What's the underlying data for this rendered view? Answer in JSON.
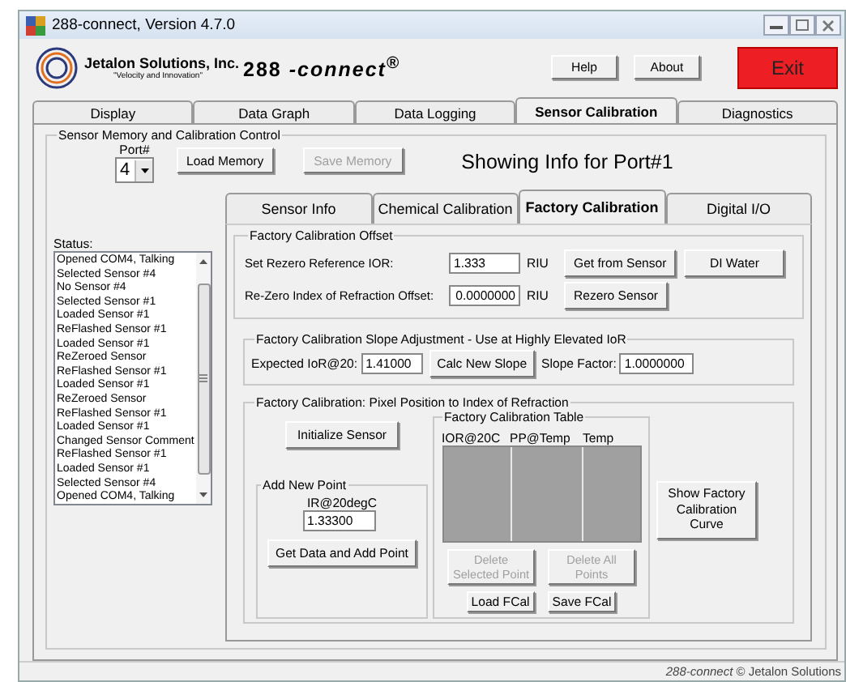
{
  "window": {
    "title": "288-connect, Version 4.7.0"
  },
  "header": {
    "company": "Jetalon Solutions, Inc.",
    "tagline": "\"Velocity and Innovation\"",
    "product": "288 *-connect*$^{®}$",
    "buttons": [
      {
        "label": "Help",
        "disabled": false
      },
      {
        "label": "About",
        "disabled": false
      }
    ],
    "exit": "Exit"
  },
  "tabs": [
    {
      "label": "Display",
      "selected": false
    },
    {
      "label": "Data Graph",
      "selected": false
    },
    {
      "label": "Data Logging",
      "selected": false
    },
    {
      "label": "Sensor Calibration",
      "selected": true
    },
    {
      "label": "Diagnostics",
      "selected": false
    }
  ],
  "memory_group": {
    "title": "Sensor Memory and Calibration Control",
    "port_label": "Port#",
    "port_value": "4",
    "buttons": [
      {
        "label": "Load Memory",
        "disabled": false
      },
      {
        "label": "Save Memory",
        "disabled": true
      }
    ],
    "showing": "Showing Info for Port#1"
  },
  "status": {
    "label": "Status:",
    "lines": [
      "Opened COM4, Talking",
      "Selected Sensor #4",
      "No Sensor #4",
      "Selected Sensor #1",
      "Loaded Sensor #1",
      "ReFlashed Sensor #1",
      "Loaded Sensor #1",
      "ReZeroed Sensor",
      "ReFlashed Sensor #1",
      "Loaded Sensor #1",
      "ReZeroed Sensor",
      "ReFlashed Sensor #1",
      "Loaded Sensor #1",
      "Changed Sensor Comment",
      "ReFlashed Sensor #1",
      "Loaded Sensor #1",
      "Selected Sensor #4",
      "Opened COM4, Talking"
    ]
  },
  "sub_tabs": [
    {
      "label": "Sensor Info",
      "selected": false
    },
    {
      "label": "Chemical Calibration",
      "selected": false
    },
    {
      "label": "Factory Calibration",
      "selected": true
    },
    {
      "label": "Digital I/O",
      "selected": false
    }
  ],
  "offset_group": {
    "title": "Factory Calibration Offset",
    "reference_label": "Set Rezero Reference IOR:",
    "reference_value": "1.333",
    "reference_unit": "RIU",
    "offset_label": "Re-Zero Index of  Refraction Offset:",
    "offset_value": "0.0000000",
    "offset_unit": "RIU",
    "buttons": [
      {
        "label": "Get from Sensor",
        "disabled": false
      },
      {
        "label": "DI Water",
        "disabled": false
      },
      {
        "label": "Rezero Sensor",
        "disabled": false
      }
    ]
  },
  "slope_group": {
    "title": "Factory Calibration Slope Adjustment - Use at Highly Elevated IoR",
    "expected_label": "Expected IoR@20:",
    "expected_value": "1.41000",
    "button": {
      "label": "Calc New Slope",
      "disabled": false
    },
    "slope_label": "Slope Factor:",
    "slope_value": "1.0000000"
  },
  "pixel_group": {
    "title": "Factory Calibration: Pixel Position to Index of Refraction",
    "initialize": {
      "label": "Initialize Sensor",
      "disabled": false
    },
    "add_point": {
      "title": "Add New Point",
      "label": "IR@20degC",
      "value": "1.33300",
      "button": {
        "label": "Get Data and Add Point",
        "disabled": false
      }
    },
    "table": {
      "title": "Factory Calibration Table",
      "columns": [
        "IOR@20C",
        "PP@Temp",
        "Temp"
      ],
      "buttons": [
        {
          "label": "Delete Selected Point",
          "disabled": true
        },
        {
          "label": "Delete All Points",
          "disabled": true
        },
        {
          "label": "Load FCal",
          "disabled": false
        },
        {
          "label": "Save FCal",
          "disabled": false
        }
      ]
    },
    "curve_button": {
      "label": "Show Factory Calibration Curve",
      "disabled": false
    }
  },
  "status_bar": "*288-connect*  © Jetalon Solutions"
}
